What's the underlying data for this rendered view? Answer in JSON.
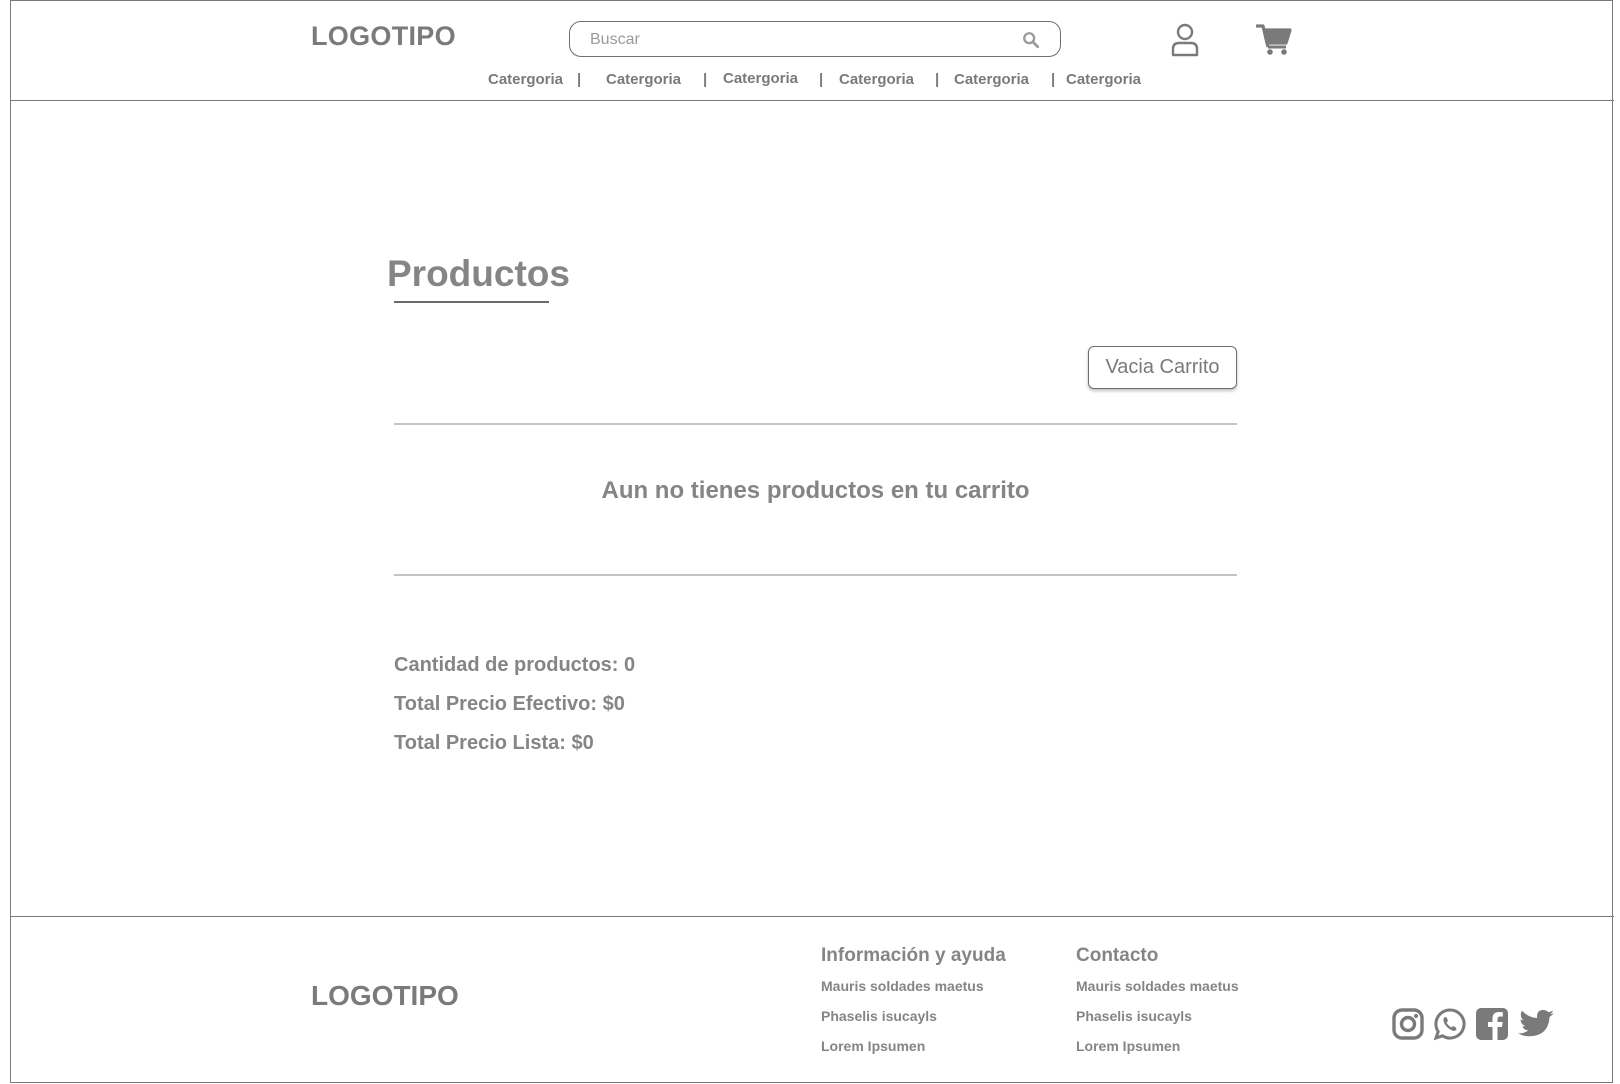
{
  "header": {
    "logo": "LOGOTIPO",
    "search_placeholder": "Buscar",
    "categories": [
      "Catergoria",
      "Catergoria",
      "Catergoria",
      "Catergoria",
      "Catergoria",
      "Catergoria"
    ],
    "separator": "|"
  },
  "main": {
    "title": "Productos",
    "empty_cart_button": "Vacia Carrito",
    "empty_message": "Aun no tienes productos en tu carrito",
    "summary": {
      "quantity": "Cantidad de productos: 0",
      "total_cash": "Total Precio Efectivo: $0",
      "total_list": "Total Precio Lista: $0"
    }
  },
  "footer": {
    "logo": "LOGOTIPO",
    "info": {
      "title": "Información y ayuda",
      "links": [
        "Mauris soldades maetus",
        "Phaselis isucayls",
        "Lorem Ipsumen"
      ]
    },
    "contact": {
      "title": "Contacto",
      "links": [
        "Mauris soldades maetus",
        "Phaselis isucayls",
        "Lorem Ipsumen"
      ]
    },
    "social_icons": [
      "instagram-icon",
      "whatsapp-icon",
      "facebook-icon",
      "twitter-icon"
    ]
  },
  "colors": {
    "text_gray": "#858585",
    "border_gray": "#7a7a7a",
    "divider_gray": "#c4c4c4"
  }
}
